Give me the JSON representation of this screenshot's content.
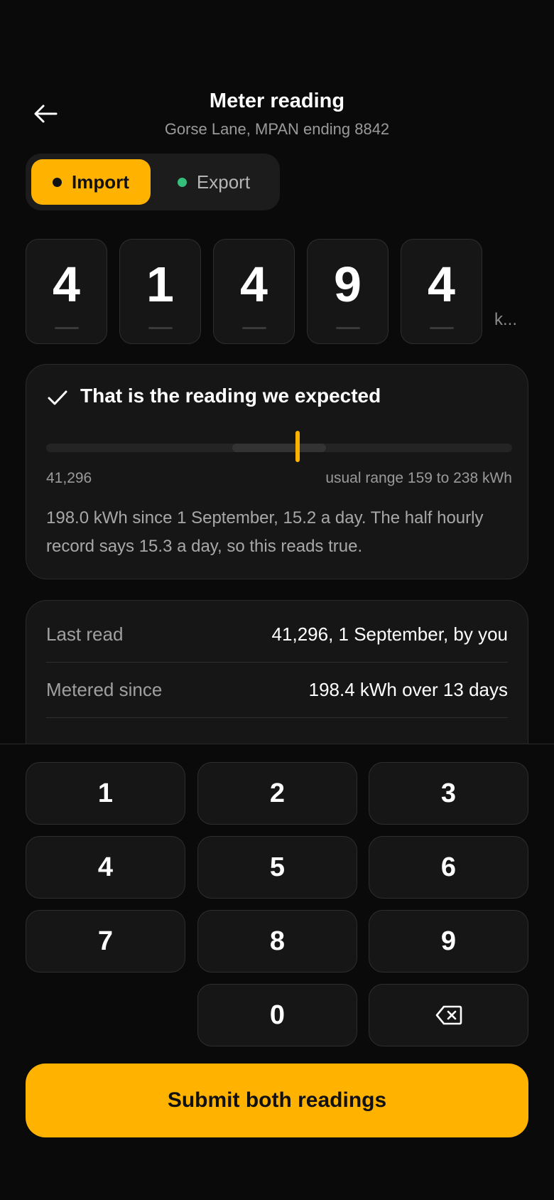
{
  "header": {
    "title": "Meter reading",
    "subtitle": "Gorse Lane, MPAN ending 8842",
    "back_icon": "arrow-left-icon"
  },
  "toggle": {
    "import_label": "Import",
    "export_label": "Export",
    "selected": "Import",
    "colors": {
      "import": "#ffb300",
      "export_dot": "#34c07a"
    }
  },
  "reading": {
    "digits": [
      "4",
      "1",
      "4",
      "9",
      "4"
    ],
    "unit": "k..."
  },
  "expected": {
    "title": "That is the reading we expected",
    "icon": "check-icon",
    "last_value": "41,296",
    "range_text": "usual range 159 to 238 kWh",
    "body": "198.0 kWh since 1 September, 15.2 a day. The half hourly record says 15.3 a day, so this reads true."
  },
  "info": {
    "rows": [
      {
        "label": "Last read",
        "value": "41,296, 1 September, by you"
      },
      {
        "label": "Metered since",
        "value": "198.4 kWh over 13 days"
      }
    ]
  },
  "keypad": {
    "keys": [
      "1",
      "2",
      "3",
      "4",
      "5",
      "6",
      "7",
      "8",
      "9",
      "0"
    ],
    "backspace_icon": "backspace-icon"
  },
  "submit_label": "Submit both readings",
  "accent_color": "#ffb300"
}
